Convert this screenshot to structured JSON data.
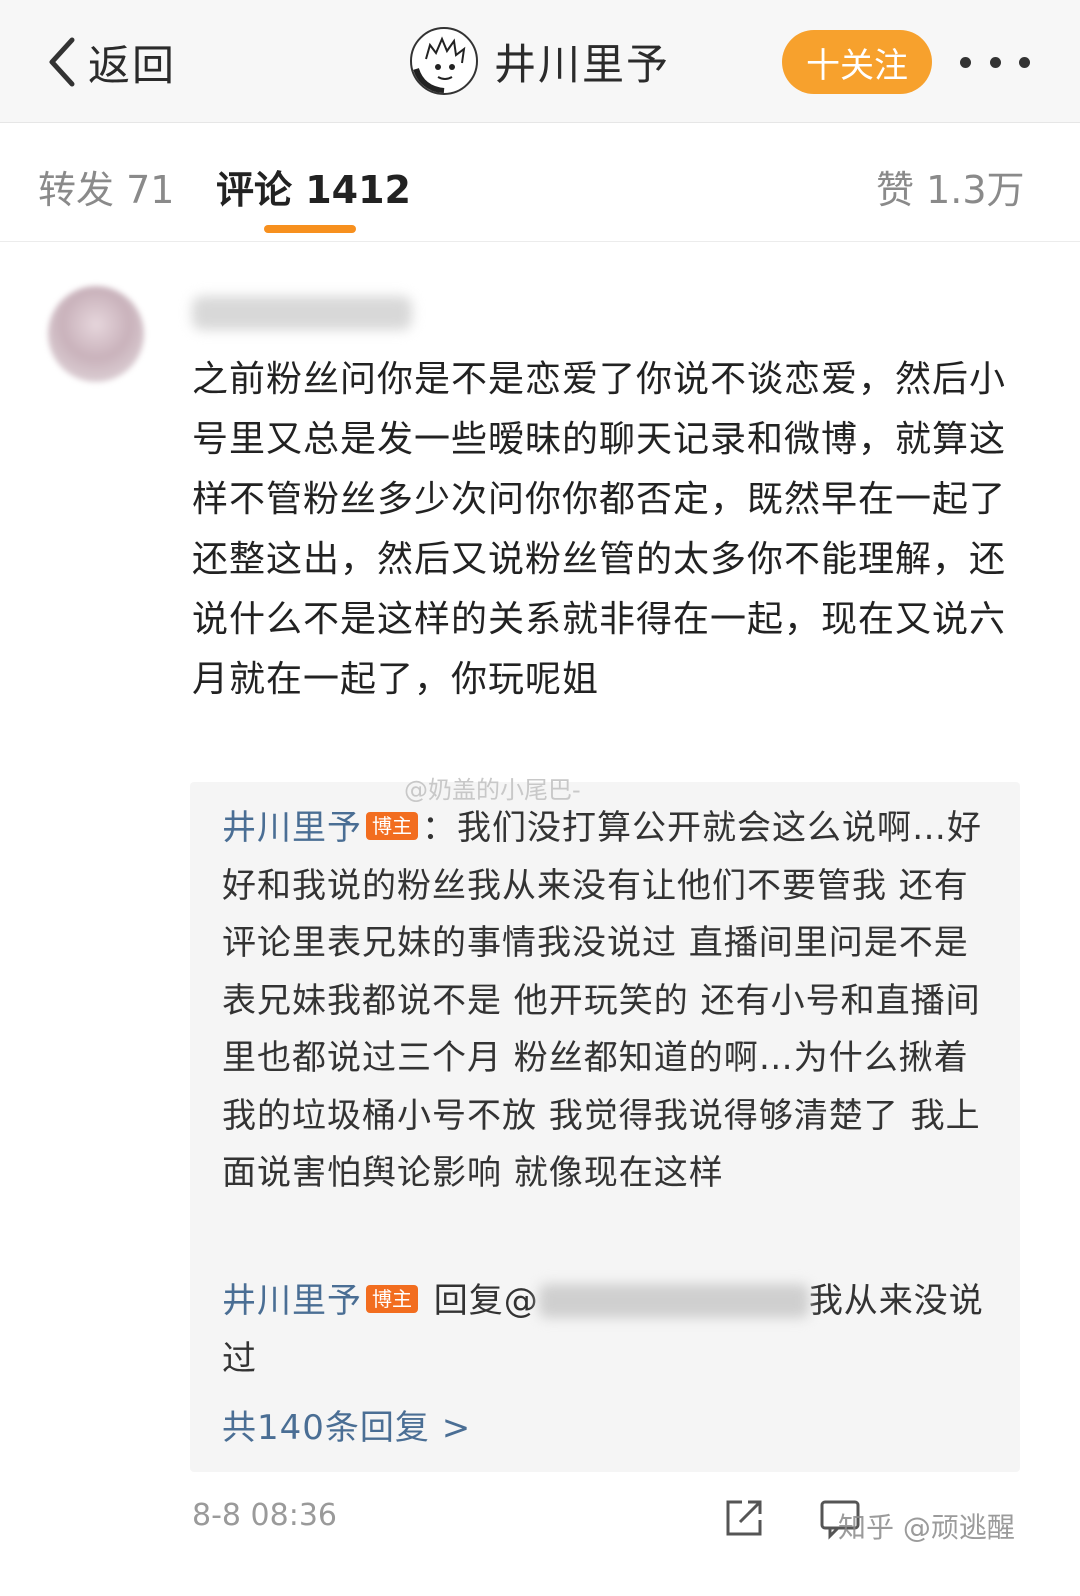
{
  "navbar": {
    "back_label": "返回",
    "title": "井川里予",
    "follow_label": "十关注"
  },
  "tabs": {
    "repost": "转发 71",
    "comments": "评论 1412",
    "likes": "赞 1.3万"
  },
  "comment": {
    "text": "之前粉丝问你是不是恋爱了你说不谈恋爱，然后小号里又总是发一些暧昧的聊天记录和微博，就算这样不管粉丝多少次问你你都否定，既然早在一起了还整这出，然后又说粉丝管的太多你不能理解，还说什么不是这样的关系就非得在一起，现在又说六月就在一起了，你玩呢姐",
    "timestamp": "8-8 08:36"
  },
  "watermark_top": "@奶盖的小尾巴-",
  "reply": {
    "author": "井川里予",
    "badge": "博主",
    "text": "：我们没打算公开就会这么说啊…好好和我说的粉丝我从来没有让他们不要管我 还有评论里表兄妹的事情我没说过 直播间里问是不是表兄妹我都说不是 他开玩笑的 还有小号和直播间里也都说过三个月 粉丝都知道的啊…为什么揪着我的垃圾桶小号不放 我觉得我说得够清楚了 我上面说害怕舆论影响 就像现在这样"
  },
  "reply2": {
    "author": "井川里予",
    "badge": "博主",
    "prefix": " 回复@",
    "suffix": "我从来没说过"
  },
  "all_replies": "共140条回复 >",
  "watermark_bottom": "知乎 @顽逃醒"
}
